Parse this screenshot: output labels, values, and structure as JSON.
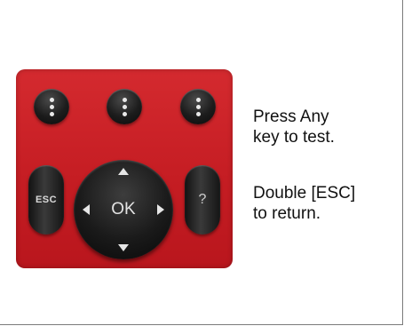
{
  "remote": {
    "top_buttons": [
      {
        "name": "menu-button-1",
        "icon": "vertical-dots-icon"
      },
      {
        "name": "menu-button-2",
        "icon": "vertical-dots-icon"
      },
      {
        "name": "menu-button-3",
        "icon": "vertical-dots-icon"
      }
    ],
    "esc_label": "ESC",
    "ok_label": "OK",
    "help_label": "?",
    "colors": {
      "panel": "#c91f25",
      "button": "#1a1a1a",
      "glyph": "#e6e6e6"
    }
  },
  "instructions": {
    "line1": "Press Any",
    "line2": "key to test.",
    "line3": "Double [ESC]",
    "line4": "to return."
  }
}
